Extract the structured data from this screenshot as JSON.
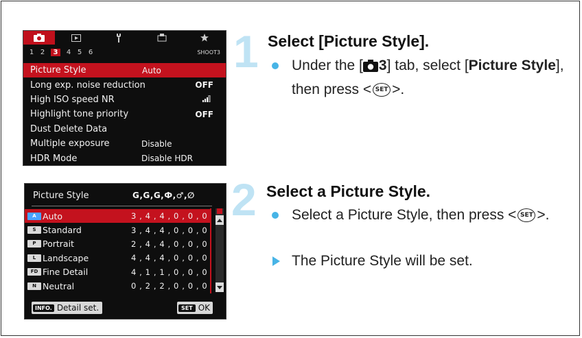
{
  "menu1": {
    "tabs": [
      "camera-icon",
      "playback-icon",
      "wrench-icon",
      "custom-icon",
      "star-icon"
    ],
    "subtabs": [
      "1",
      "2",
      "3",
      "4",
      "5",
      "6"
    ],
    "active_subtab": "3",
    "subtab_name": "SHOOT3",
    "items": [
      {
        "label": "Picture Style",
        "value": "Auto"
      },
      {
        "label": "Long exp. noise reduction",
        "value": "OFF"
      },
      {
        "label": "High ISO speed NR",
        "value": ""
      },
      {
        "label": "Highlight tone priority",
        "value": "OFF"
      },
      {
        "label": "Dust Delete Data",
        "value": ""
      },
      {
        "label": "Multiple exposure",
        "value": "Disable"
      },
      {
        "label": "HDR Mode",
        "value": "Disable HDR"
      }
    ]
  },
  "menu2": {
    "title": "Picture Style",
    "params": "Ǥ,Ǥ,Ǥ,Ф,♂,∅",
    "rows": [
      {
        "badge": "A",
        "label": "Auto",
        "values": "3 , 4 , 4 , 0 , 0 , 0"
      },
      {
        "badge": "S",
        "label": "Standard",
        "values": "3 , 4 , 4 , 0 , 0 , 0"
      },
      {
        "badge": "P",
        "label": "Portrait",
        "values": "2 , 4 , 4 , 0 , 0 , 0"
      },
      {
        "badge": "L",
        "label": "Landscape",
        "values": "4 , 4 , 4 , 0 , 0 , 0"
      },
      {
        "badge": "FD",
        "label": "Fine Detail",
        "values": "4 , 1 , 1 , 0 , 0 , 0"
      },
      {
        "badge": "N",
        "label": "Neutral",
        "values": "0 , 2 , 2 , 0 , 0 , 0"
      }
    ],
    "info_key": "INFO.",
    "info_label": "Detail set.",
    "set_key": "SET",
    "set_label": "OK"
  },
  "step1": {
    "number": "1",
    "title": "Select [Picture Style].",
    "text_a": "Under the [",
    "text_tab": "3",
    "text_b": "] tab, select [",
    "text_bold": "Picture Style",
    "text_c": "], then press <",
    "set": "SET",
    "text_d": ">."
  },
  "step2": {
    "number": "2",
    "title": "Select a Picture Style.",
    "text_a": "Select a Picture Style, then press <",
    "set": "SET",
    "text_b": ">.",
    "result": "The Picture Style will be set."
  },
  "colors": {
    "accent": "#47b4e6",
    "menu_red": "#c4121e",
    "step_number": "#bfe3f4"
  }
}
